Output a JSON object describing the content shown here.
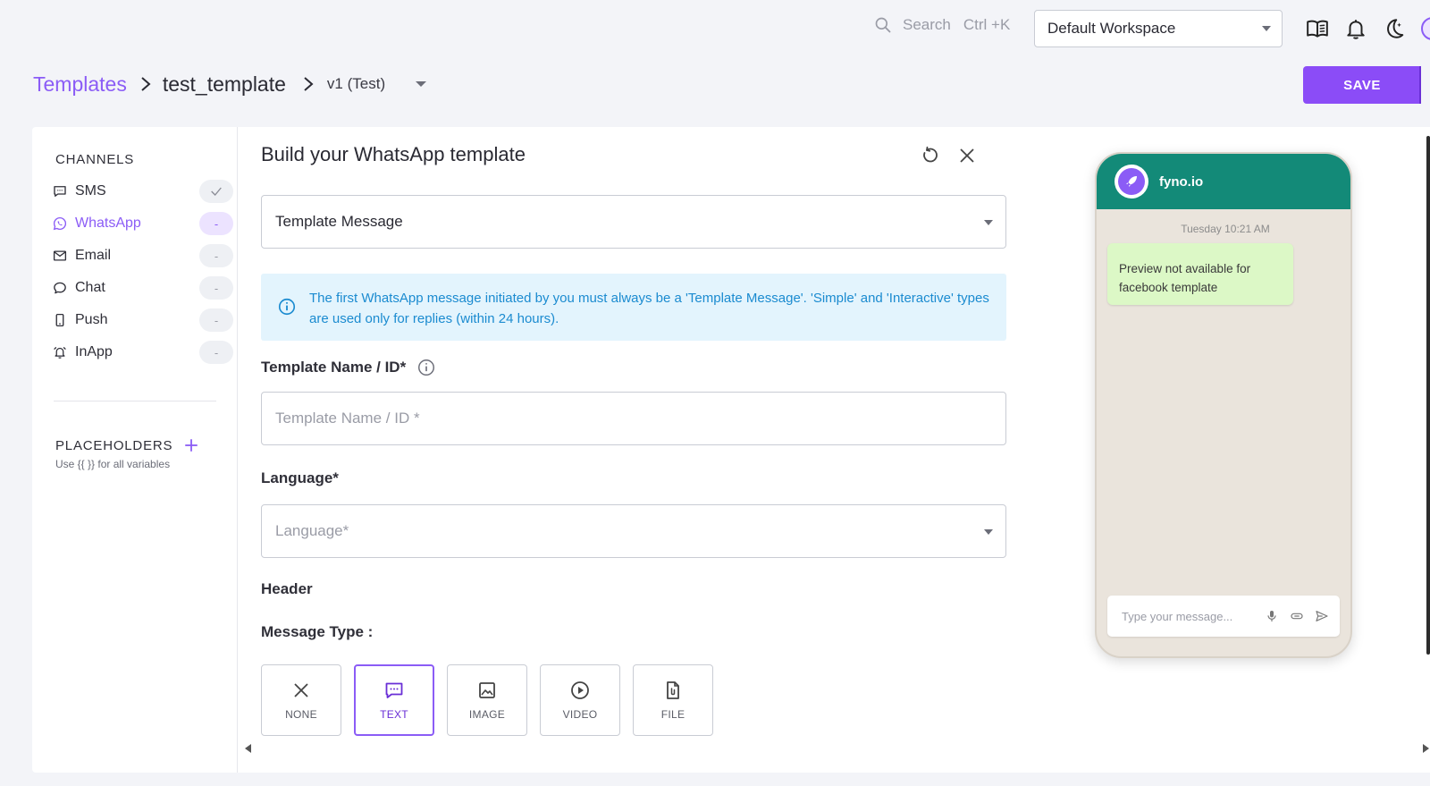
{
  "topbar": {
    "search_label": "Search",
    "search_shortcut": "Ctrl +K",
    "workspace": "Default Workspace",
    "icons": [
      "docs-icon",
      "bell-icon",
      "moon-icon"
    ]
  },
  "breadcrumb": {
    "root": "Templates",
    "current": "test_template",
    "version": "v1 (Test)"
  },
  "save_label": "SAVE",
  "channels": {
    "title": "CHANNELS",
    "items": [
      {
        "label": "SMS",
        "status": "✓"
      },
      {
        "label": "WhatsApp",
        "status": "-"
      },
      {
        "label": "Email",
        "status": "-"
      },
      {
        "label": "Chat",
        "status": "-"
      },
      {
        "label": "Push",
        "status": "-"
      },
      {
        "label": "InApp",
        "status": "-"
      }
    ]
  },
  "placeholders": {
    "title": "PLACEHOLDERS",
    "hint": "Use {{ }} for all variables"
  },
  "form": {
    "title": "Build your WhatsApp template",
    "message_category": "Template Message",
    "info": "The first WhatsApp message initiated by you must always be a 'Template Message'. 'Simple' and 'Interactive' types are used only for replies (within 24 hours).",
    "template_name_label": "Template Name / ID*",
    "template_name_placeholder": "Template Name / ID *",
    "language_label": "Language*",
    "language_placeholder": "Language*",
    "header_label": "Header",
    "message_type_label": "Message Type :",
    "message_types": [
      {
        "label": "NONE",
        "icon": "close-icon"
      },
      {
        "label": "TEXT",
        "icon": "chat-text-icon",
        "selected": true
      },
      {
        "label": "IMAGE",
        "icon": "image-icon"
      },
      {
        "label": "VIDEO",
        "icon": "play-icon"
      },
      {
        "label": "FILE",
        "icon": "file-icon"
      }
    ]
  },
  "preview": {
    "name": "fyno.io",
    "time": "Tuesday 10:21 AM",
    "message": "Preview not available for facebook template",
    "input_placeholder": "Type your message..."
  },
  "colors": {
    "accent": "#8b5cf6",
    "whatsapp_header": "#138a78",
    "bubble": "#dcf8c6",
    "info_bg": "#e3f4fd",
    "info_text": "#1b8bd0"
  }
}
